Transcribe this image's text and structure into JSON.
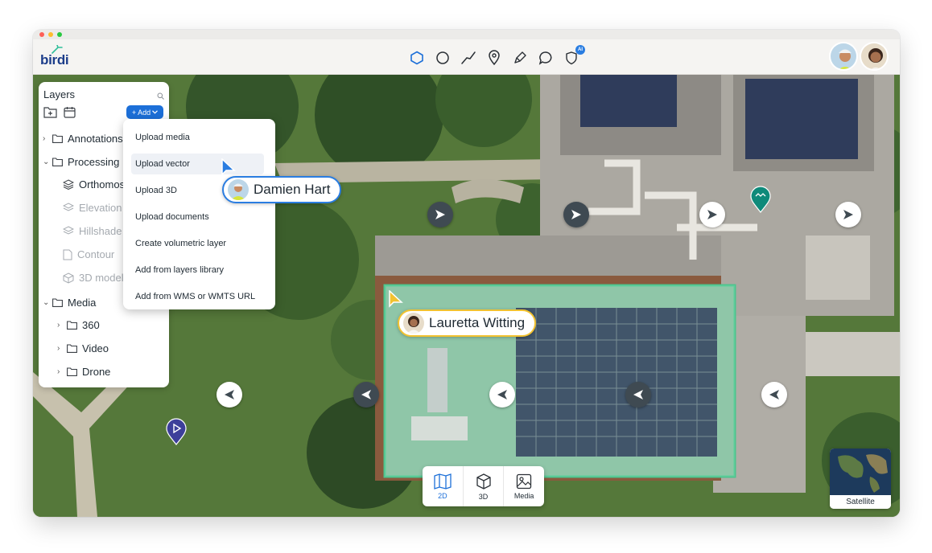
{
  "app": {
    "logo_text": "birdi"
  },
  "toolbar": {
    "tools": [
      "polygon-tool-icon",
      "circle-tool-icon",
      "line-tool-icon",
      "pin-tool-icon",
      "pen-tool-icon",
      "comment-tool-icon",
      "ai-shield-icon"
    ],
    "ai_badge": "AI",
    "active_color": "#1c6fd8"
  },
  "layers": {
    "title": "Layers",
    "add_label": "+ Add",
    "items": [
      {
        "label": "Annotations",
        "expanded": false
      },
      {
        "label": "Processing",
        "expanded": true
      },
      {
        "label": "Orthomosaic",
        "icon": "layers-icon"
      },
      {
        "label": "Elevation",
        "icon": "layers-icon"
      },
      {
        "label": "Hillshade",
        "icon": "layers-icon"
      },
      {
        "label": "Contour",
        "icon": "document-icon"
      },
      {
        "label": "3D model",
        "icon": "cube-icon"
      },
      {
        "label": "Media",
        "expanded": true
      },
      {
        "label": "360"
      },
      {
        "label": "Video"
      },
      {
        "label": "Drone"
      }
    ]
  },
  "add_menu": {
    "items": [
      "Upload media",
      "Upload vector",
      "Upload 3D",
      "Upload documents",
      "Create volumetric layer",
      "Add from layers library",
      "Add from WMS or WMTS URL"
    ]
  },
  "collaborators": {
    "user1": {
      "name": "Damien Hart",
      "color": "#2a7de1"
    },
    "user2": {
      "name": "Lauretta Witting",
      "color": "#f2c230"
    }
  },
  "bottom_toolbar": {
    "items": [
      "2D",
      "3D",
      "Media"
    ],
    "active": "2D"
  },
  "basemap": {
    "label": "Satellite"
  }
}
